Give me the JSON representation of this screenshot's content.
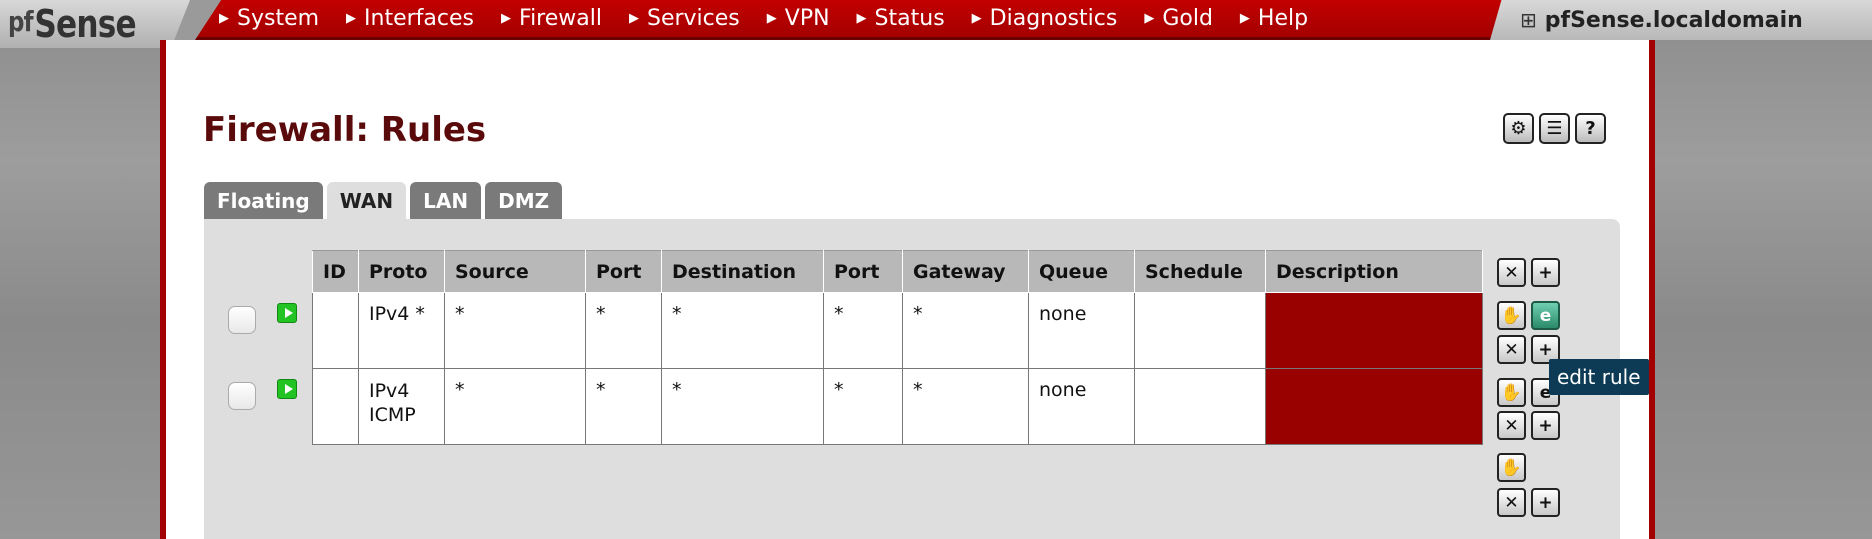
{
  "brand": {
    "logo_text": "Sense",
    "logo_glyph": "pf"
  },
  "nav": {
    "items": [
      {
        "label": "System"
      },
      {
        "label": "Interfaces"
      },
      {
        "label": "Firewall"
      },
      {
        "label": "Services"
      },
      {
        "label": "VPN"
      },
      {
        "label": "Status"
      },
      {
        "label": "Diagnostics"
      },
      {
        "label": "Gold"
      },
      {
        "label": "Help"
      }
    ],
    "hostname": "pfSense.localdomain"
  },
  "page": {
    "title": "Firewall: Rules",
    "tabs": [
      {
        "label": "Floating",
        "active": false
      },
      {
        "label": "WAN",
        "active": true
      },
      {
        "label": "LAN",
        "active": false
      },
      {
        "label": "DMZ",
        "active": false
      }
    ]
  },
  "table": {
    "headers": [
      "ID",
      "Proto",
      "Source",
      "Port",
      "Destination",
      "Port",
      "Gateway",
      "Queue",
      "Schedule",
      "Description"
    ],
    "rows": [
      {
        "id": "",
        "proto": "IPv4 *",
        "source": "*",
        "sport": "*",
        "destination": "*",
        "dport": "*",
        "gateway": "*",
        "queue": "none",
        "schedule": "",
        "description": ""
      },
      {
        "id": "",
        "proto": "IPv4 ICMP",
        "source": "*",
        "sport": "*",
        "destination": "*",
        "dport": "*",
        "gateway": "*",
        "queue": "none",
        "schedule": "",
        "description": ""
      }
    ]
  },
  "tooltip": {
    "text": "edit rule"
  },
  "colors": {
    "nav_red": "#b00000",
    "desc_red": "#990000",
    "pass_green": "#22c322",
    "title": "#5a0a0a"
  }
}
